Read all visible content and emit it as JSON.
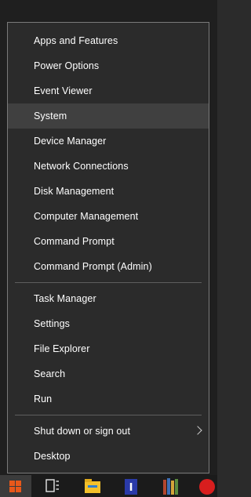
{
  "menu": {
    "group1": [
      {
        "label": "Apps and Features",
        "name": "menu-item-apps-and-features"
      },
      {
        "label": "Power Options",
        "name": "menu-item-power-options"
      },
      {
        "label": "Event Viewer",
        "name": "menu-item-event-viewer"
      },
      {
        "label": "System",
        "name": "menu-item-system"
      },
      {
        "label": "Device Manager",
        "name": "menu-item-device-manager"
      },
      {
        "label": "Network Connections",
        "name": "menu-item-network-connections"
      },
      {
        "label": "Disk Management",
        "name": "menu-item-disk-management"
      },
      {
        "label": "Computer Management",
        "name": "menu-item-computer-management"
      },
      {
        "label": "Command Prompt",
        "name": "menu-item-command-prompt"
      },
      {
        "label": "Command Prompt (Admin)",
        "name": "menu-item-command-prompt-admin"
      }
    ],
    "group2": [
      {
        "label": "Task Manager",
        "name": "menu-item-task-manager"
      },
      {
        "label": "Settings",
        "name": "menu-item-settings"
      },
      {
        "label": "File Explorer",
        "name": "menu-item-file-explorer"
      },
      {
        "label": "Search",
        "name": "menu-item-search"
      },
      {
        "label": "Run",
        "name": "menu-item-run"
      }
    ],
    "group3": [
      {
        "label": "Shut down or sign out",
        "name": "menu-item-shut-down-or-sign-out"
      },
      {
        "label": "Desktop",
        "name": "menu-item-desktop"
      }
    ],
    "highlighted_item": "System"
  },
  "taskbar": {
    "icons": [
      "windows-start-icon",
      "task-view-icon",
      "file-explorer-icon",
      "text-editor-icon",
      "books-icon",
      "red-app-icon"
    ]
  },
  "colors": {
    "menu_background": "#2b2b2b",
    "highlight": "#404040",
    "text": "#ffffff",
    "start_logo": "#e8581a"
  }
}
